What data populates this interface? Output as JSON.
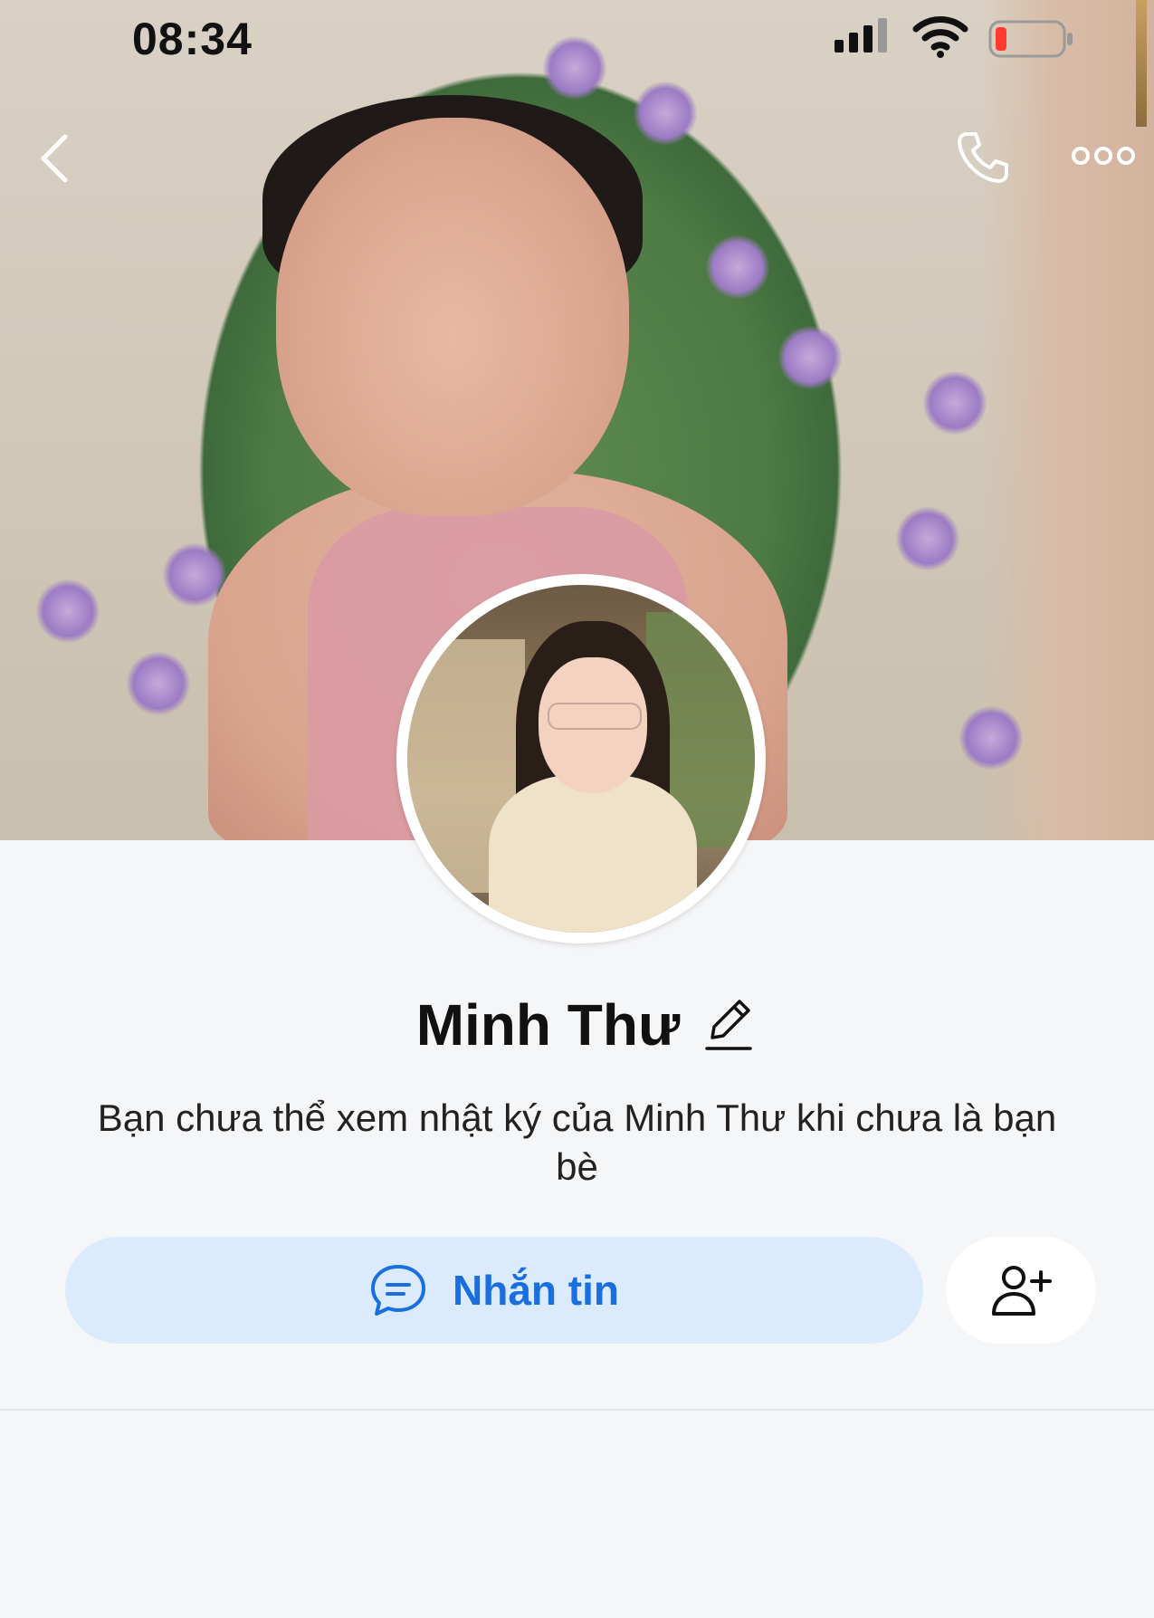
{
  "status_bar": {
    "time": "08:34"
  },
  "nav": {
    "back_icon": "chevron-left-icon",
    "call_icon": "phone-icon",
    "more_icon": "more-horizontal-icon"
  },
  "profile": {
    "name": "Minh Thư",
    "description": "Bạn chưa thể xem nhật ký của Minh Thư khi chưa là bạn bè"
  },
  "actions": {
    "message_label": "Nhắn tin",
    "message_icon": "chat-bubble-icon",
    "add_friend_icon": "add-user-icon"
  },
  "colors": {
    "accent": "#1a6fe0",
    "message_button_bg": "#dbeafc",
    "page_bg": "#f5f6f8",
    "battery_low": "#ff3b30"
  }
}
